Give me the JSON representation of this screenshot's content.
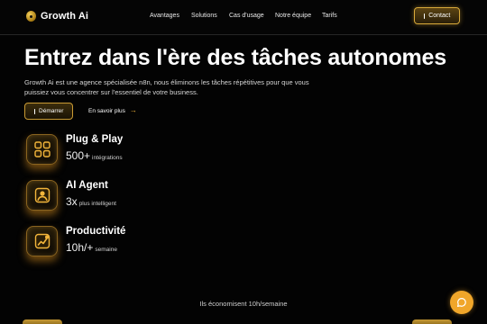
{
  "brand": {
    "name": "Growth Ai",
    "logo_icon": "growth-ai-logo-icon"
  },
  "nav": {
    "items": [
      {
        "label": "Avantages"
      },
      {
        "label": "Solutions"
      },
      {
        "label": "Cas d'usage"
      },
      {
        "label": "Notre équipe"
      },
      {
        "label": "Tarifs"
      }
    ],
    "contact_label": "Contact"
  },
  "hero": {
    "title": "Entrez dans l'ère des tâches autonomes",
    "description": "Growth Ai est une agence spécialisée n8n, nous éliminons les tâches répétitives pour que vous puissiez vous concentrer sur l'essentiel de votre business.",
    "primary_cta": "Démarrer",
    "secondary_cta": "En savoir plus",
    "arrow_glyph": "→"
  },
  "features": [
    {
      "title": "Plug & Play",
      "stat": "500+",
      "stat_label": "intégrations",
      "icon": "grid-apps-icon"
    },
    {
      "title": "AI Agent",
      "stat": "3x",
      "stat_label": "plus intelligent",
      "icon": "user-agent-icon"
    },
    {
      "title": "Productivité",
      "stat": "10h/+",
      "stat_label": "semaine",
      "icon": "growth-chart-icon"
    }
  ],
  "footer_note": "Ils économisent 10h/semaine",
  "colors": {
    "accent": "#f0a62a",
    "gold_border": "#d9a93a",
    "background": "#030303"
  }
}
